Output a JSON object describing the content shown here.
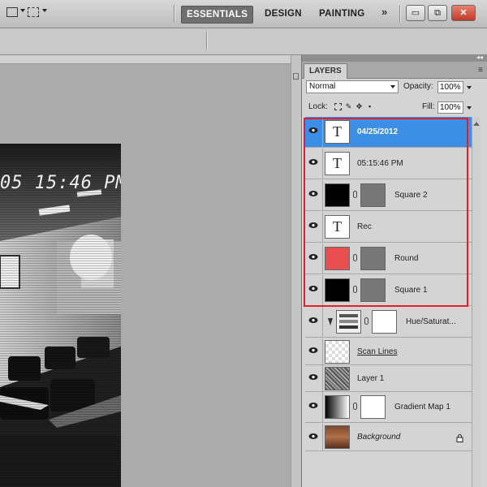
{
  "workspaces": {
    "essentials": "ESSENTIALS",
    "design": "DESIGN",
    "painting": "PAINTING",
    "more": "»"
  },
  "window_controls": {
    "minimize": "▭",
    "restore": "⧉",
    "close": "✕"
  },
  "canvas": {
    "timestamp_overlay": "05 15:46 PM"
  },
  "layers_panel": {
    "tab_label": "LAYERS",
    "menu_icon": "panel-menu-icon",
    "blend_mode": "Normal",
    "opacity_label": "Opacity:",
    "opacity_value": "100%",
    "lock_label": "Lock:",
    "fill_label": "Fill:",
    "fill_value": "100%",
    "layers": [
      {
        "name": "04/25/2012",
        "type": "text",
        "selected": true
      },
      {
        "name": "05:15:46 PM",
        "type": "text",
        "selected": false
      },
      {
        "name": "Square 2",
        "type": "shape",
        "fill": "#000000",
        "selected": false
      },
      {
        "name": "Rec",
        "type": "text",
        "selected": false
      },
      {
        "name": "Round",
        "type": "shape",
        "fill": "#e85050",
        "selected": false
      },
      {
        "name": "Square 1",
        "type": "shape",
        "fill": "#000000",
        "selected": false
      },
      {
        "name": "Hue/Saturat...",
        "type": "adjustment",
        "selected": false
      },
      {
        "name": "Scan Lines",
        "type": "pattern",
        "selected": false
      },
      {
        "name": "Layer 1",
        "type": "noise",
        "selected": false
      },
      {
        "name": "Gradient Map 1",
        "type": "adjustment",
        "selected": false
      },
      {
        "name": "Background",
        "type": "background",
        "locked": true,
        "selected": false
      }
    ]
  },
  "colors": {
    "selection_blue": "#3c8fe4",
    "highlight_red": "#e0202a",
    "red_swatch": "#e85050"
  }
}
